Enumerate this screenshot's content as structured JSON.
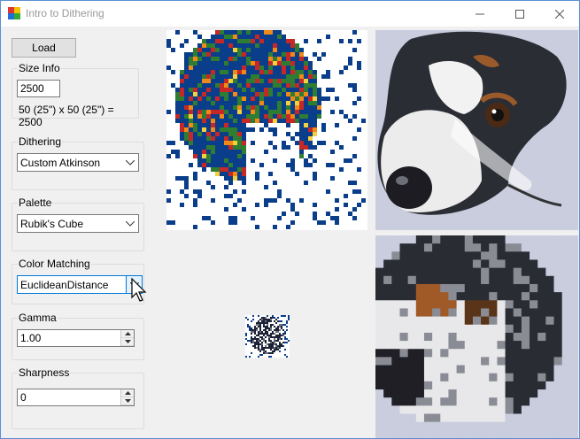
{
  "window": {
    "title": "Intro to Dithering"
  },
  "toolbar": {
    "load_label": "Load"
  },
  "size_info": {
    "group_label": "Size Info",
    "value": "2500",
    "formula": "50 (25\") x 50 (25\") = 2500"
  },
  "dithering": {
    "group_label": "Dithering",
    "selected": "Custom Atkinson"
  },
  "palette": {
    "group_label": "Palette",
    "selected": "Rubik's Cube"
  },
  "color_matching": {
    "group_label": "Color Matching",
    "selected": "EuclideanDistance"
  },
  "gamma": {
    "group_label": "Gamma",
    "value": "1.00"
  },
  "sharpness": {
    "group_label": "Sharpness",
    "value": "0"
  },
  "colors": {
    "accent": "#0078d7",
    "dither_blue": "#0a3d8a",
    "dither_green": "#2e7d32",
    "dither_red": "#c62828",
    "dither_orange": "#ef8a17",
    "dither_yellow": "#f4d03f",
    "photo_bg": "#c9cddd"
  }
}
